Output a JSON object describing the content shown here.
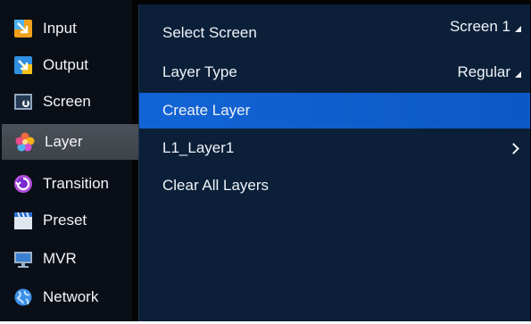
{
  "sidebar": {
    "items": [
      {
        "label": "Input",
        "icon": "input-icon"
      },
      {
        "label": "Output",
        "icon": "output-icon"
      },
      {
        "label": "Screen",
        "icon": "screen-icon"
      },
      {
        "label": "Layer",
        "icon": "layer-icon",
        "active": true
      },
      {
        "label": "Transition",
        "icon": "transition-icon"
      },
      {
        "label": "Preset",
        "icon": "preset-icon"
      },
      {
        "label": "MVR",
        "icon": "mvr-icon"
      },
      {
        "label": "Network",
        "icon": "network-icon"
      }
    ]
  },
  "panel": {
    "select_screen": {
      "label": "Select Screen",
      "value": "Screen 1"
    },
    "layer_type": {
      "label": "Layer Type",
      "value": "Regular"
    },
    "create_layer": {
      "label": "Create Layer"
    },
    "layer_item": {
      "label": "L1_Layer1"
    },
    "clear_all": {
      "label": "Clear All Layers"
    }
  },
  "colors": {
    "panel_bg": "#0b1f38",
    "highlight": "#1264d6",
    "sidebar_bg": "#0a0f17",
    "active_item": "#474c53"
  }
}
